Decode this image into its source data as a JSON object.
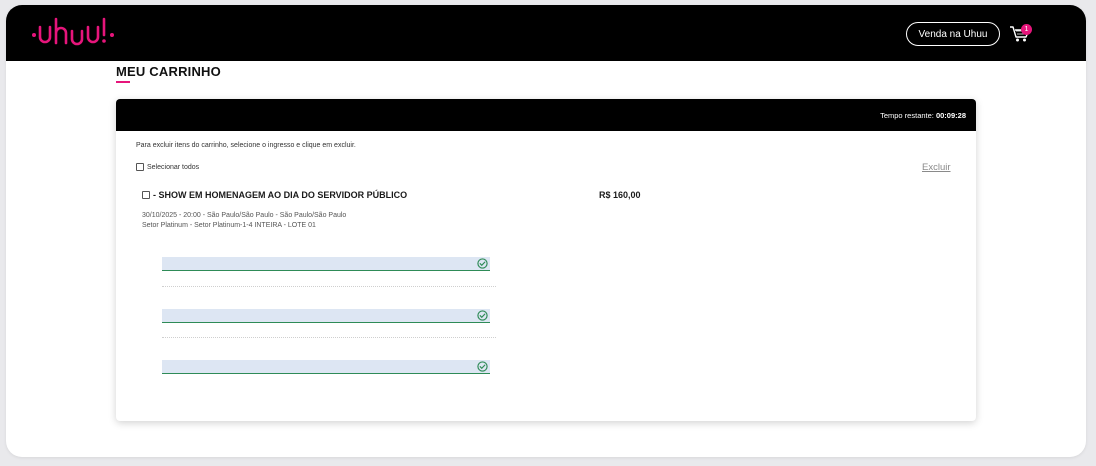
{
  "header": {
    "logo_text": "·uhuu!·",
    "sell_button": "Venda na Uhuu",
    "cart_count": "1"
  },
  "page": {
    "title": "MEU CARRINHO"
  },
  "cart": {
    "timer_label": "Tempo restante:",
    "timer_value": "00:09:28",
    "instructions": "Para excluir itens do carrinho, selecione o ingresso e clique em excluir.",
    "select_all_label": "Selecionar todos",
    "delete_label": "Excluir",
    "items": [
      {
        "title": "- SHOW EM HOMENAGEM AO DIA DO SERVIDOR PÚBLICO",
        "price": "R$ 160,00",
        "date_location": "30/10/2025 - 20:00 - São Paulo/São Paulo - São Paulo/São Paulo",
        "sector": "Setor Platinum - Setor Platinum-1-4 INTEIRA - LOTE 01"
      }
    ]
  },
  "colors": {
    "accent": "#e6157b",
    "header_bg": "#000000",
    "valid_green": "#2e8b57",
    "field_bg": "#dde6f3"
  },
  "icons": {
    "cart": "cart-icon",
    "field_valid": "check-circle-icon"
  }
}
